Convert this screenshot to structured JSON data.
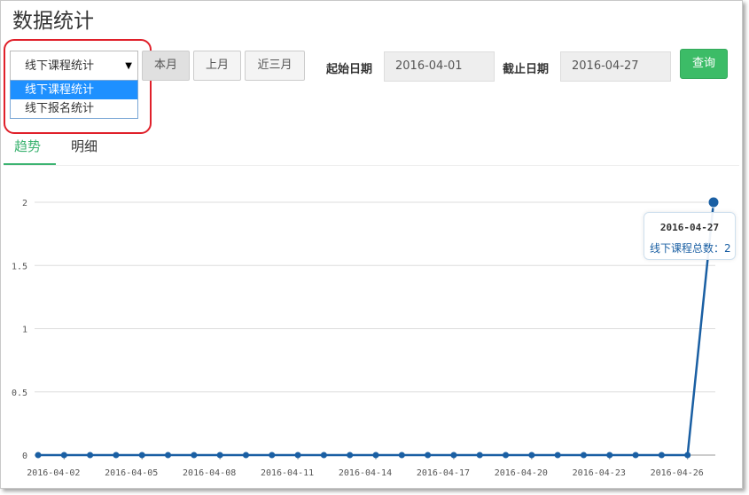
{
  "page": {
    "title": "数据统计"
  },
  "filter": {
    "selected": "线下课程统计",
    "options": [
      "线下课程统计",
      "线下报名统计"
    ],
    "range_buttons": [
      "本月",
      "上月",
      "近三月"
    ],
    "start_label": "起始日期",
    "start_value": "2016-04-01",
    "end_label": "截止日期",
    "end_value": "2016-04-27",
    "query_label": "查询"
  },
  "tabs": [
    "趋势",
    "明细"
  ],
  "tooltip": {
    "date": "2016-04-27",
    "series_label": "线下课程总数",
    "value_text": "2"
  },
  "colors": {
    "accent": "#3cb371",
    "series": "#1a5fa3",
    "highlight": "#e0202a"
  },
  "chart_data": {
    "type": "line",
    "x": [
      "2016-04-01",
      "2016-04-02",
      "2016-04-03",
      "2016-04-04",
      "2016-04-05",
      "2016-04-06",
      "2016-04-07",
      "2016-04-08",
      "2016-04-09",
      "2016-04-10",
      "2016-04-11",
      "2016-04-12",
      "2016-04-13",
      "2016-04-14",
      "2016-04-15",
      "2016-04-16",
      "2016-04-17",
      "2016-04-18",
      "2016-04-19",
      "2016-04-20",
      "2016-04-21",
      "2016-04-22",
      "2016-04-23",
      "2016-04-24",
      "2016-04-25",
      "2016-04-26",
      "2016-04-27"
    ],
    "series": [
      {
        "name": "线下课程总数",
        "values": [
          0,
          0,
          0,
          0,
          0,
          0,
          0,
          0,
          0,
          0,
          0,
          0,
          0,
          0,
          0,
          0,
          0,
          0,
          0,
          0,
          0,
          0,
          0,
          0,
          0,
          0,
          2
        ]
      }
    ],
    "x_tick_labels": [
      "2016-04-02",
      "2016-04-05",
      "2016-04-08",
      "2016-04-11",
      "2016-04-14",
      "2016-04-17",
      "2016-04-20",
      "2016-04-23",
      "2016-04-26"
    ],
    "y_ticks": [
      "0",
      "0.5",
      "1",
      "1.5",
      "2"
    ],
    "ylim": [
      0,
      2
    ],
    "grid": true
  }
}
